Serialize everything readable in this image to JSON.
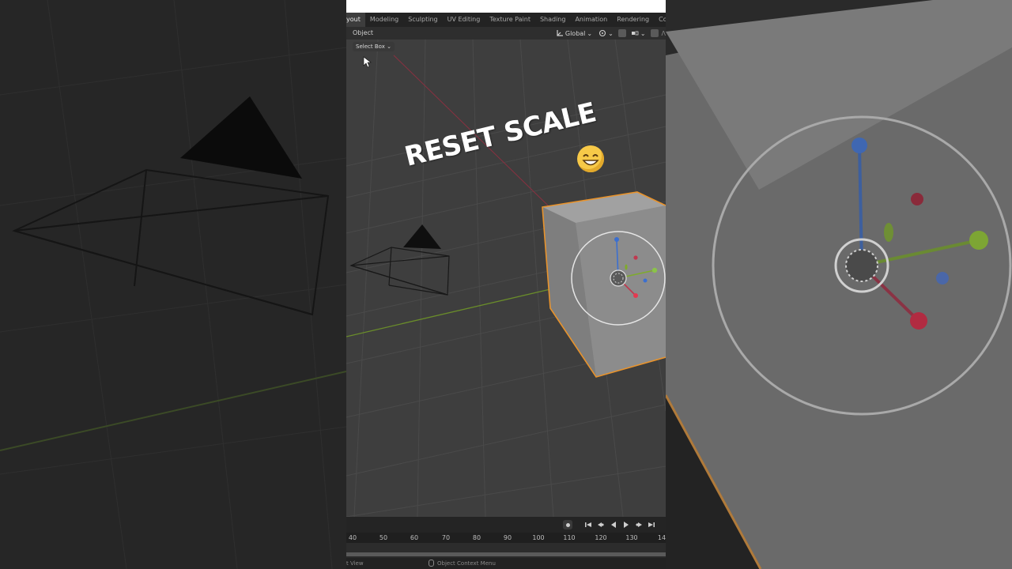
{
  "overlay": {
    "caption": "RESET SCALE"
  },
  "workspace_tabs": [
    {
      "label": "yout",
      "active": true
    },
    {
      "label": "Modeling",
      "active": false
    },
    {
      "label": "Sculpting",
      "active": false
    },
    {
      "label": "UV Editing",
      "active": false
    },
    {
      "label": "Texture Paint",
      "active": false
    },
    {
      "label": "Shading",
      "active": false
    },
    {
      "label": "Animation",
      "active": false
    },
    {
      "label": "Rendering",
      "active": false
    },
    {
      "label": "Compositing",
      "active": false
    }
  ],
  "header": {
    "menu_object": "Object",
    "orientation": "Global",
    "orientation_icon": "transform-orientation-icon",
    "pivot_icon": "pivot-icon",
    "snap_icon": "snap-icon",
    "proportional_icon": "proportional-edit-icon"
  },
  "tool": {
    "select_mode": "Select Box"
  },
  "timeline": {
    "frame_numbers": [
      "40",
      "50",
      "60",
      "70",
      "80",
      "90",
      "100",
      "110",
      "120",
      "130",
      "14"
    ],
    "controls": [
      "record-icon",
      "jump-start-icon",
      "prev-keyframe-icon",
      "play-reverse-icon",
      "play-icon",
      "next-keyframe-icon",
      "jump-end-icon"
    ]
  },
  "status_bar": {
    "left": "t View",
    "middle": "Object Context Menu"
  },
  "colors": {
    "selection_outline": "#e8932c",
    "x_axis": "#c0384f",
    "y_axis": "#7fab2c",
    "z_axis": "#3b6fd0",
    "viewport_bg": "#3e3e3e"
  }
}
